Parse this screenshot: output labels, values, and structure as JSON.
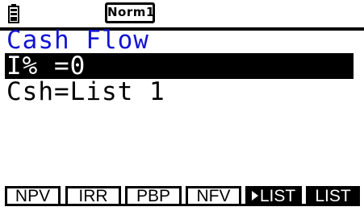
{
  "status": {
    "battery_icon": "battery-icon",
    "mode": "Norm1"
  },
  "screen": {
    "title": "Cash Flow",
    "lines": [
      {
        "text": "I% =0",
        "selected": true
      },
      {
        "text": "Csh=List 1",
        "selected": false
      }
    ]
  },
  "function_keys": [
    {
      "label": "NPV",
      "style": "outline"
    },
    {
      "label": "IRR",
      "style": "outline"
    },
    {
      "label": "PBP",
      "style": "outline"
    },
    {
      "label": "NFV",
      "style": "outline"
    },
    {
      "label": "LIST",
      "style": "filled",
      "icon": "right-triangle-icon"
    },
    {
      "label": "LIST",
      "style": "filled"
    }
  ],
  "colors": {
    "title": "#1414d2",
    "foreground": "#000000",
    "background": "#ffffff"
  }
}
